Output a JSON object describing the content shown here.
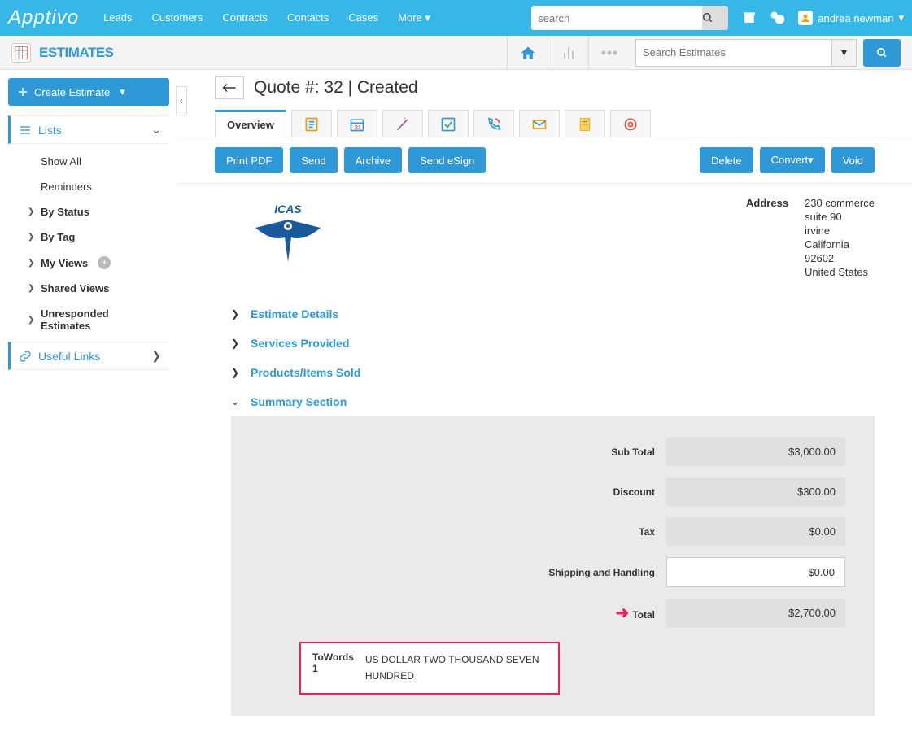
{
  "header": {
    "brand": "Apptivo",
    "nav": [
      "Leads",
      "Customers",
      "Contracts",
      "Contacts",
      "Cases",
      "More"
    ],
    "search_placeholder": "search",
    "user_name": "andrea newman"
  },
  "app": {
    "title": "ESTIMATES",
    "search_placeholder": "Search Estimates"
  },
  "sidebar": {
    "create_label": "Create Estimate",
    "lists_label": "Lists",
    "items": [
      {
        "label": "Show All",
        "chev": false
      },
      {
        "label": "Reminders",
        "chev": false
      },
      {
        "label": "By Status",
        "chev": true
      },
      {
        "label": "By Tag",
        "chev": true
      },
      {
        "label": "My Views",
        "chev": true,
        "plus": true
      },
      {
        "label": "Shared Views",
        "chev": true
      },
      {
        "label": "Unresponded Estimates",
        "chev": true
      }
    ],
    "useful_links": "Useful Links"
  },
  "page": {
    "title": "Quote #: 32 | Created",
    "tabs": {
      "overview": "Overview"
    },
    "actions": {
      "print": "Print PDF",
      "send": "Send",
      "archive": "Archive",
      "esign": "Send eSign",
      "delete": "Delete",
      "convert": "Convert",
      "void": "Void"
    },
    "address_label": "Address",
    "address": [
      "230 commerce",
      "suite 90",
      "irvine",
      "California",
      "92602",
      "United States"
    ],
    "accordion": {
      "details": "Estimate Details",
      "services": "Services Provided",
      "products": "Products/Items Sold",
      "summary": "Summary Section"
    },
    "summary": {
      "subtotal": {
        "label": "Sub Total",
        "value": "$3,000.00"
      },
      "discount": {
        "label": "Discount",
        "value": "$300.00"
      },
      "tax": {
        "label": "Tax",
        "value": "$0.00"
      },
      "shipping": {
        "label": "Shipping and Handling",
        "value": "$0.00"
      },
      "total": {
        "label": "Total",
        "value": "$2,700.00"
      }
    },
    "towords": {
      "label": "ToWords 1",
      "value": "US DOLLAR TWO THOUSAND SEVEN HUNDRED"
    }
  }
}
